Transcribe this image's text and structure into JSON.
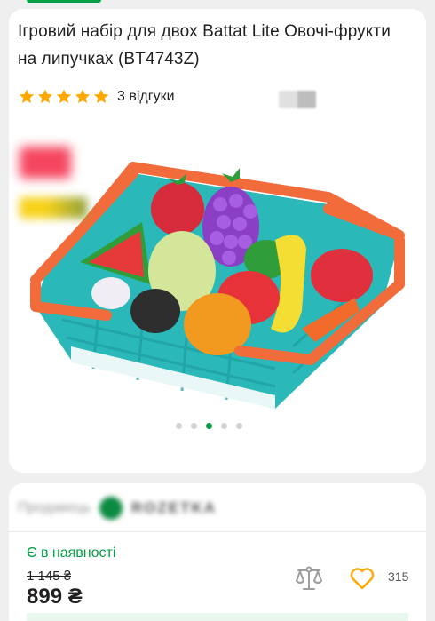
{
  "product": {
    "title": "Ігровий набір для двох Battat Lite Овочі-фрукти на липучках (BT4743Z)",
    "rating_stars": 5,
    "reviews": "3 відгуки"
  },
  "gallery": {
    "dots_total": 5,
    "active_dot": 3
  },
  "seller": {
    "label": "Продавець",
    "name": "ROZETKA"
  },
  "offer": {
    "availability": "Є в наявності",
    "old_price": "1 145 ₴",
    "price": "899 ₴",
    "wishlist_count": "315"
  },
  "colors": {
    "accent": "#00a046",
    "star": "#ffa900",
    "heart": "#ffa900"
  }
}
